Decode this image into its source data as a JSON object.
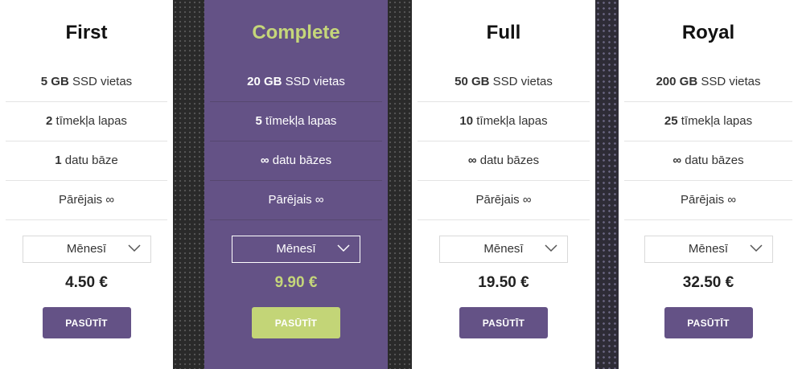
{
  "colors": {
    "accent_purple": "#645286",
    "accent_green": "#c3d577",
    "highlight_title": "#c5d67a",
    "background_dark": "#2c2c2c"
  },
  "plans": [
    {
      "name": "First",
      "storage_value": "5 GB",
      "storage_text": " SSD vietas",
      "sites_value": "2",
      "sites_text": " tīmekļa lapas",
      "db_value": "1",
      "db_text": " datu bāze",
      "other": "Pārējais ∞",
      "period": "Mēnesī",
      "price": "4.50 €",
      "order": "PASŪTĪT"
    },
    {
      "name": "Complete",
      "storage_value": "20 GB",
      "storage_text": " SSD vietas",
      "sites_value": "5",
      "sites_text": " tīmekļa lapas",
      "db_value": "∞",
      "db_text": " datu bāzes",
      "other": "Pārējais ∞",
      "period": "Mēnesī",
      "price": "9.90 €",
      "order": "PASŪTĪT"
    },
    {
      "name": "Full",
      "storage_value": "50 GB",
      "storage_text": " SSD vietas",
      "sites_value": "10",
      "sites_text": " tīmekļa lapas",
      "db_value": "∞",
      "db_text": " datu bāzes",
      "other": "Pārējais ∞",
      "period": "Mēnesī",
      "price": "19.50 €",
      "order": "PASŪTĪT"
    },
    {
      "name": "Royal",
      "storage_value": "200 GB",
      "storage_text": " SSD vietas",
      "sites_value": "25",
      "sites_text": " tīmekļa lapas",
      "db_value": "∞",
      "db_text": " datu bāzes",
      "other": "Pārējais ∞",
      "period": "Mēnesī",
      "price": "32.50 €",
      "order": "PASŪTĪT"
    }
  ]
}
